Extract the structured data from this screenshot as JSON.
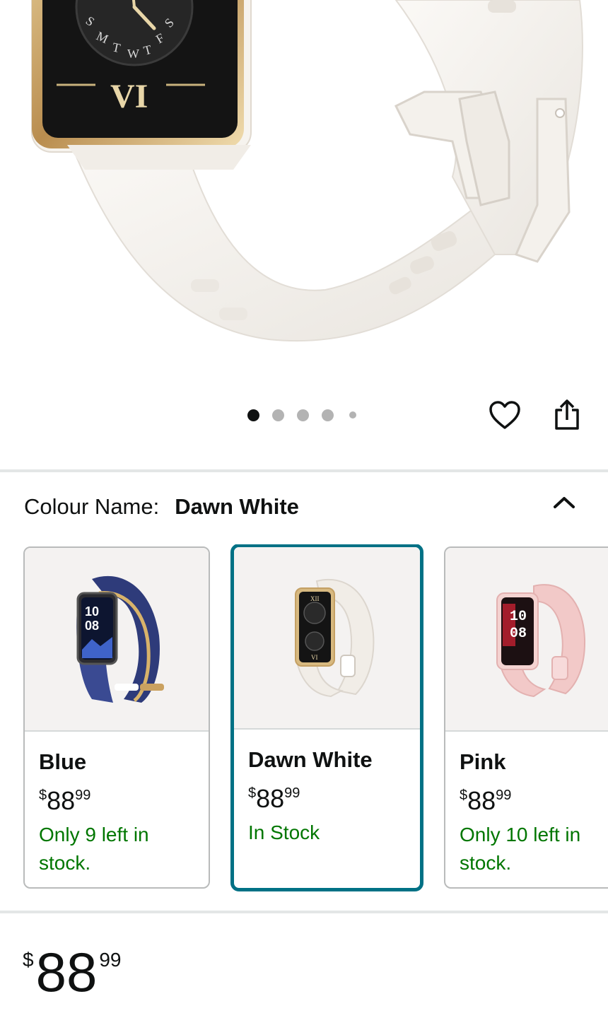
{
  "product_image": {
    "icon": "smartwatch-dawn-white-photo"
  },
  "carousel": {
    "total_dots": 5,
    "active_index": 0
  },
  "actions": {
    "wishlist_icon": "heart-icon",
    "share_icon": "share-icon"
  },
  "colour": {
    "label": "Colour Name:",
    "value": "Dawn White",
    "collapse_icon": "chevron-up-icon"
  },
  "swatches": [
    {
      "name": "Blue",
      "currency": "$",
      "price_whole": "88",
      "price_fraction": "99",
      "stock": "Only 9 left in stock.",
      "selected": false,
      "color": "#2e3b7a"
    },
    {
      "name": "Dawn White",
      "currency": "$",
      "price_whole": "88",
      "price_fraction": "99",
      "stock": "In Stock",
      "selected": true,
      "color": "#f3efe9"
    },
    {
      "name": "Pink",
      "currency": "$",
      "price_whole": "88",
      "price_fraction": "99",
      "stock": "Only 10 left in stock.",
      "selected": false,
      "color": "#f2c9c8"
    }
  ],
  "price": {
    "currency": "$",
    "whole": "88",
    "fraction": "99"
  },
  "colors": {
    "accent": "#007185",
    "in_stock": "#007600",
    "divider": "#e3e6e6"
  }
}
